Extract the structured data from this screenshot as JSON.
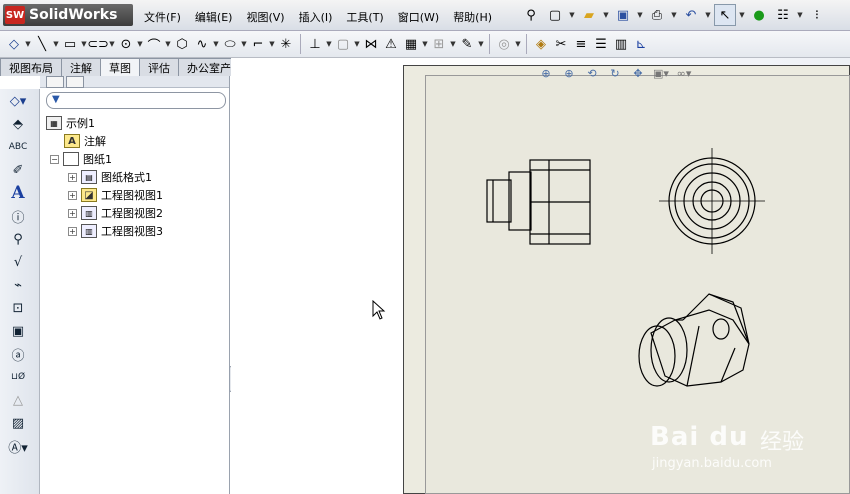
{
  "app": {
    "logo_badge": "SW",
    "logo_text": "SolidWorks"
  },
  "menu": [
    "文件(F)",
    "编辑(E)",
    "视图(V)",
    "插入(I)",
    "工具(T)",
    "窗口(W)",
    "帮助(H)"
  ],
  "tabs": [
    {
      "label": "视图布局",
      "active": false
    },
    {
      "label": "注解",
      "active": false
    },
    {
      "label": "草图",
      "active": true
    },
    {
      "label": "评估",
      "active": false
    },
    {
      "label": "办公室产品",
      "active": false
    }
  ],
  "tree": {
    "root": "示例1",
    "items": [
      {
        "label": "注解",
        "level": 1,
        "icon": "annotation-icon"
      },
      {
        "label": "图纸1",
        "level": 1,
        "icon": "sheet-icon",
        "expander": "−"
      },
      {
        "label": "图纸格式1",
        "level": 2,
        "icon": "sheet-format-icon",
        "expander": "+"
      },
      {
        "label": "工程图视图1",
        "level": 2,
        "icon": "drawing-view-icon",
        "expander": "+"
      },
      {
        "label": "工程图视图2",
        "level": 2,
        "icon": "drawing-view-icon",
        "expander": "+"
      },
      {
        "label": "工程图视图3",
        "level": 2,
        "icon": "drawing-view-icon",
        "expander": "+"
      }
    ]
  },
  "watermark": {
    "logo": "Bai  du",
    "cn": "经验",
    "url": "jingyan.baidu.com"
  }
}
